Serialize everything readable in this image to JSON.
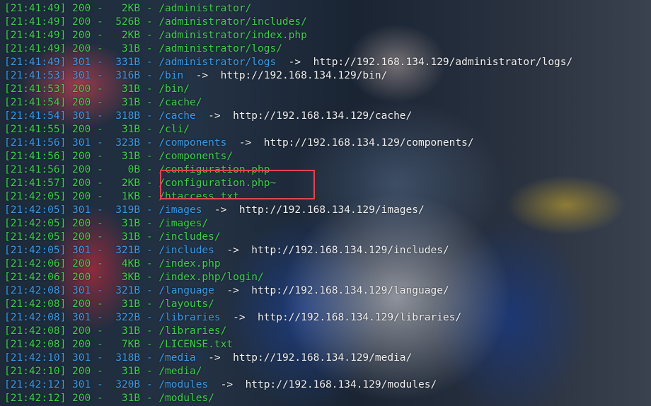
{
  "terminal": {
    "lines": [
      {
        "time": "[21:41:49]",
        "code": "200",
        "size": "2KB",
        "path": "/administrator/",
        "arrow": "",
        "url": ""
      },
      {
        "time": "[21:41:49]",
        "code": "200",
        "size": "526B",
        "path": "/administrator/includes/",
        "arrow": "",
        "url": ""
      },
      {
        "time": "[21:41:49]",
        "code": "200",
        "size": "2KB",
        "path": "/administrator/index.php",
        "arrow": "",
        "url": ""
      },
      {
        "time": "[21:41:49]",
        "code": "200",
        "size": "31B",
        "path": "/administrator/logs/",
        "arrow": "",
        "url": ""
      },
      {
        "time": "[21:41:49]",
        "code": "301",
        "size": "331B",
        "path": "/administrator/logs",
        "arrow": "->",
        "url": "http://192.168.134.129/administrator/logs/"
      },
      {
        "time": "[21:41:53]",
        "code": "301",
        "size": "316B",
        "path": "/bin",
        "arrow": "->",
        "url": "http://192.168.134.129/bin/"
      },
      {
        "time": "[21:41:53]",
        "code": "200",
        "size": "31B",
        "path": "/bin/",
        "arrow": "",
        "url": ""
      },
      {
        "time": "[21:41:54]",
        "code": "200",
        "size": "31B",
        "path": "/cache/",
        "arrow": "",
        "url": ""
      },
      {
        "time": "[21:41:54]",
        "code": "301",
        "size": "318B",
        "path": "/cache",
        "arrow": "->",
        "url": "http://192.168.134.129/cache/"
      },
      {
        "time": "[21:41:55]",
        "code": "200",
        "size": "31B",
        "path": "/cli/",
        "arrow": "",
        "url": ""
      },
      {
        "time": "[21:41:56]",
        "code": "301",
        "size": "323B",
        "path": "/components",
        "arrow": "->",
        "url": "http://192.168.134.129/components/"
      },
      {
        "time": "[21:41:56]",
        "code": "200",
        "size": "31B",
        "path": "/components/",
        "arrow": "",
        "url": ""
      },
      {
        "time": "[21:41:56]",
        "code": "200",
        "size": "0B",
        "path": "/configuration.php",
        "arrow": "",
        "url": ""
      },
      {
        "time": "[21:41:57]",
        "code": "200",
        "size": "2KB",
        "path": "/configuration.php~",
        "arrow": "",
        "url": ""
      },
      {
        "time": "[21:42:05]",
        "code": "200",
        "size": "1KB",
        "path": "/htaccess.txt",
        "arrow": "",
        "url": ""
      },
      {
        "time": "[21:42:05]",
        "code": "301",
        "size": "319B",
        "path": "/images",
        "arrow": "->",
        "url": "http://192.168.134.129/images/"
      },
      {
        "time": "[21:42:05]",
        "code": "200",
        "size": "31B",
        "path": "/images/",
        "arrow": "",
        "url": ""
      },
      {
        "time": "[21:42:05]",
        "code": "200",
        "size": "31B",
        "path": "/includes/",
        "arrow": "",
        "url": ""
      },
      {
        "time": "[21:42:05]",
        "code": "301",
        "size": "321B",
        "path": "/includes",
        "arrow": "->",
        "url": "http://192.168.134.129/includes/"
      },
      {
        "time": "[21:42:06]",
        "code": "200",
        "size": "4KB",
        "path": "/index.php",
        "arrow": "",
        "url": ""
      },
      {
        "time": "[21:42:06]",
        "code": "200",
        "size": "3KB",
        "path": "/index.php/login/",
        "arrow": "",
        "url": ""
      },
      {
        "time": "[21:42:08]",
        "code": "301",
        "size": "321B",
        "path": "/language",
        "arrow": "->",
        "url": "http://192.168.134.129/language/"
      },
      {
        "time": "[21:42:08]",
        "code": "200",
        "size": "31B",
        "path": "/layouts/",
        "arrow": "",
        "url": ""
      },
      {
        "time": "[21:42:08]",
        "code": "301",
        "size": "322B",
        "path": "/libraries",
        "arrow": "->",
        "url": "http://192.168.134.129/libraries/"
      },
      {
        "time": "[21:42:08]",
        "code": "200",
        "size": "31B",
        "path": "/libraries/",
        "arrow": "",
        "url": ""
      },
      {
        "time": "[21:42:08]",
        "code": "200",
        "size": "7KB",
        "path": "/LICENSE.txt",
        "arrow": "",
        "url": ""
      },
      {
        "time": "[21:42:10]",
        "code": "301",
        "size": "318B",
        "path": "/media",
        "arrow": "->",
        "url": "http://192.168.134.129/media/"
      },
      {
        "time": "[21:42:10]",
        "code": "200",
        "size": "31B",
        "path": "/media/",
        "arrow": "",
        "url": ""
      },
      {
        "time": "[21:42:12]",
        "code": "301",
        "size": "320B",
        "path": "/modules",
        "arrow": "->",
        "url": "http://192.168.134.129/modules/"
      },
      {
        "time": "[21:42:12]",
        "code": "200",
        "size": "31B",
        "path": "/modules/",
        "arrow": "",
        "url": ""
      }
    ],
    "colors": {
      "status_200": "#3fcf4a",
      "status_301": "#3b9be8",
      "redirect_text": "#f0f0f0",
      "highlight_box": "#e0454f"
    }
  }
}
